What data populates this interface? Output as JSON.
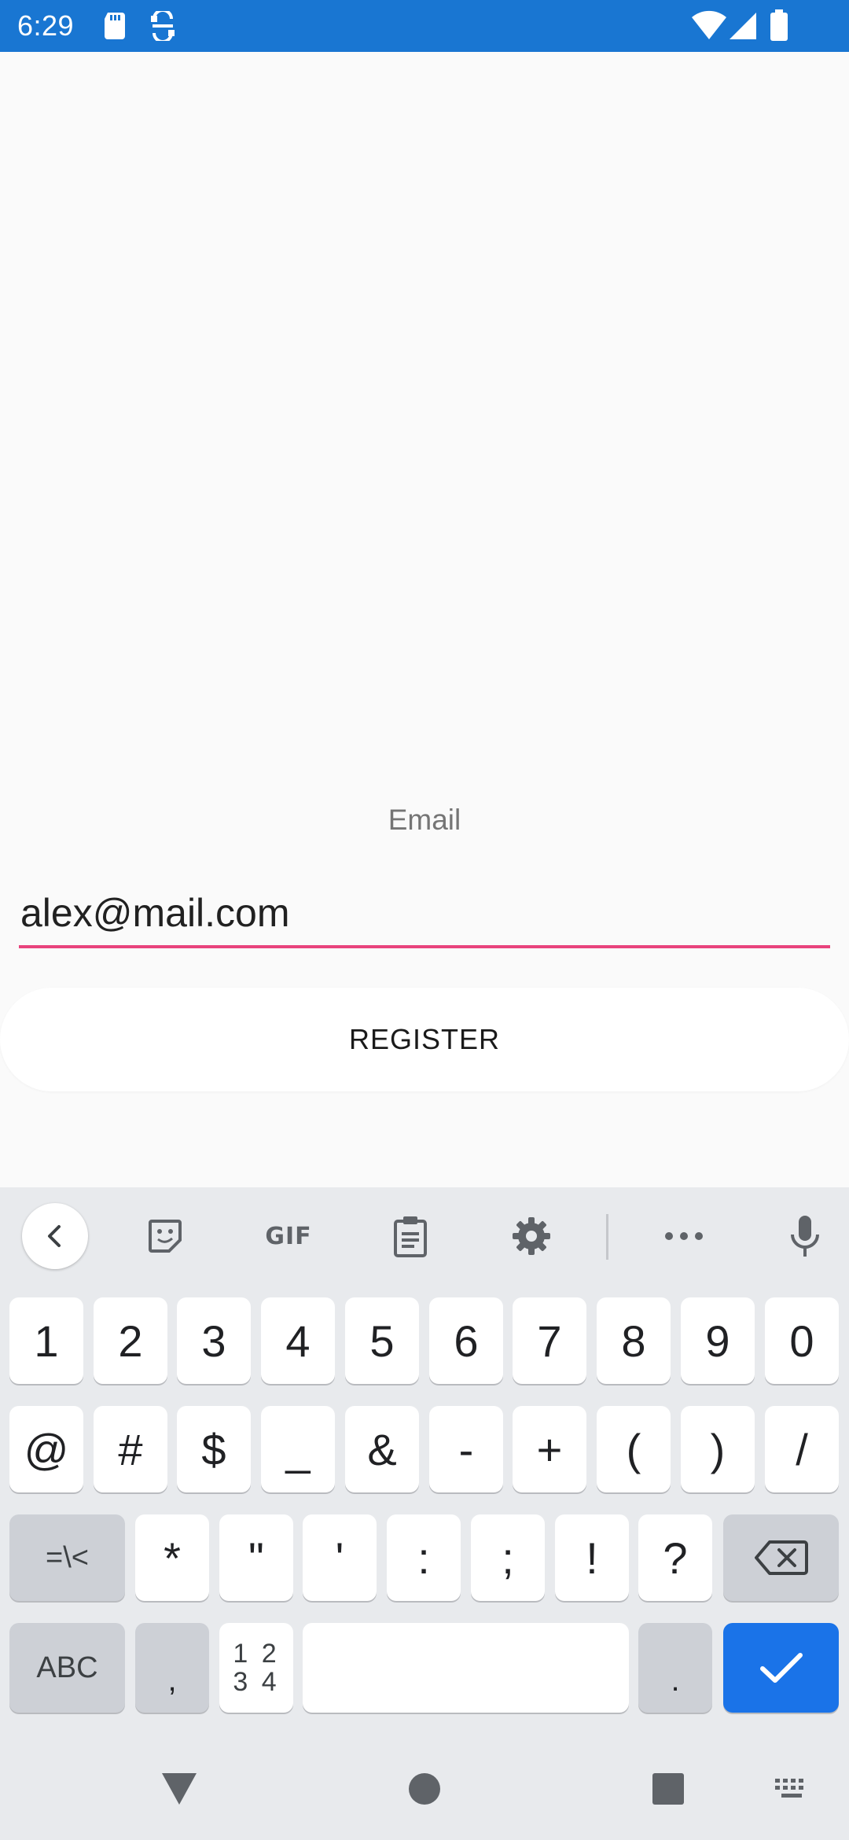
{
  "status_bar": {
    "time": "6:29",
    "color": "#1976d2",
    "left_icons": [
      "sd-card-icon",
      "screenshot-sync-icon"
    ],
    "right_icons": [
      "wifi-icon",
      "signal-icon",
      "battery-icon"
    ]
  },
  "form": {
    "email_label": "Email",
    "email_value": "alex@mail.com",
    "accent_color": "#e8437d",
    "register_label": "REGISTER"
  },
  "keyboard": {
    "toolbar": {
      "back": "chevron-left-icon",
      "sticker": "sticker-icon",
      "gif_label": "GIF",
      "clipboard": "clipboard-icon",
      "settings": "gear-icon",
      "more": "more-icon",
      "mic": "mic-icon"
    },
    "row1": [
      "1",
      "2",
      "3",
      "4",
      "5",
      "6",
      "7",
      "8",
      "9",
      "0"
    ],
    "row2": [
      "@",
      "#",
      "$",
      "_",
      "&",
      "-",
      "+",
      "(",
      ")",
      "/"
    ],
    "row3": [
      "=\\<",
      "*",
      "\"",
      "'",
      ":",
      ";",
      "!",
      "?"
    ],
    "row4": {
      "abc_label": "ABC",
      "comma": ",",
      "numpad_top": "1 2",
      "numpad_bottom": "3 4",
      "period": ".",
      "enter_icon": "checkmark-icon"
    },
    "action_color": "#1a73e8"
  },
  "nav_bar": [
    "back-triangle-icon",
    "home-circle-icon",
    "recents-square-icon",
    "keyboard-switch-icon"
  ]
}
